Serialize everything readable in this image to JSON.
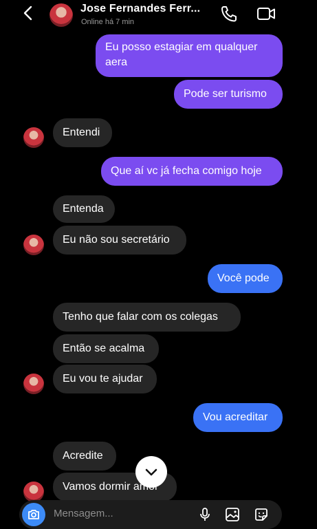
{
  "header": {
    "contact_name": "Jose Fernandes Ferr...",
    "status": "Online há 7 min",
    "icons": [
      "back-arrow-icon",
      "phone-icon",
      "video-camera-icon"
    ]
  },
  "messages": [
    {
      "direction": "sent",
      "color": "#7b4cf0",
      "text": "Eu posso estagiar em qualquer aera"
    },
    {
      "direction": "sent",
      "color": "#7b4cf0",
      "text": "Pode ser turismo"
    },
    {
      "direction": "received",
      "text": "Entendi"
    },
    {
      "direction": "sent",
      "color": "#7b4cf0",
      "text": "Que aí vc já fecha comigo hoje"
    },
    {
      "direction": "received",
      "text": "Entenda"
    },
    {
      "direction": "received",
      "text": "Eu não sou secretário"
    },
    {
      "direction": "sent",
      "color": "#3a72f5",
      "text": "Você pode"
    },
    {
      "direction": "received",
      "text": "Tenho que falar com os colegas"
    },
    {
      "direction": "received",
      "text": "Então se acalma"
    },
    {
      "direction": "received",
      "text": "Eu vou te ajudar"
    },
    {
      "direction": "sent",
      "color": "#3a72f5",
      "text": "Vou acreditar"
    },
    {
      "direction": "received",
      "text": "Acredite"
    },
    {
      "direction": "received",
      "text": "Vamos dormir amor"
    }
  ],
  "composer": {
    "placeholder": "Mensagem...",
    "icons": [
      "camera-icon",
      "microphone-icon",
      "gallery-icon",
      "sticker-icon"
    ]
  },
  "scroll_button_icon": "chevron-down-icon"
}
